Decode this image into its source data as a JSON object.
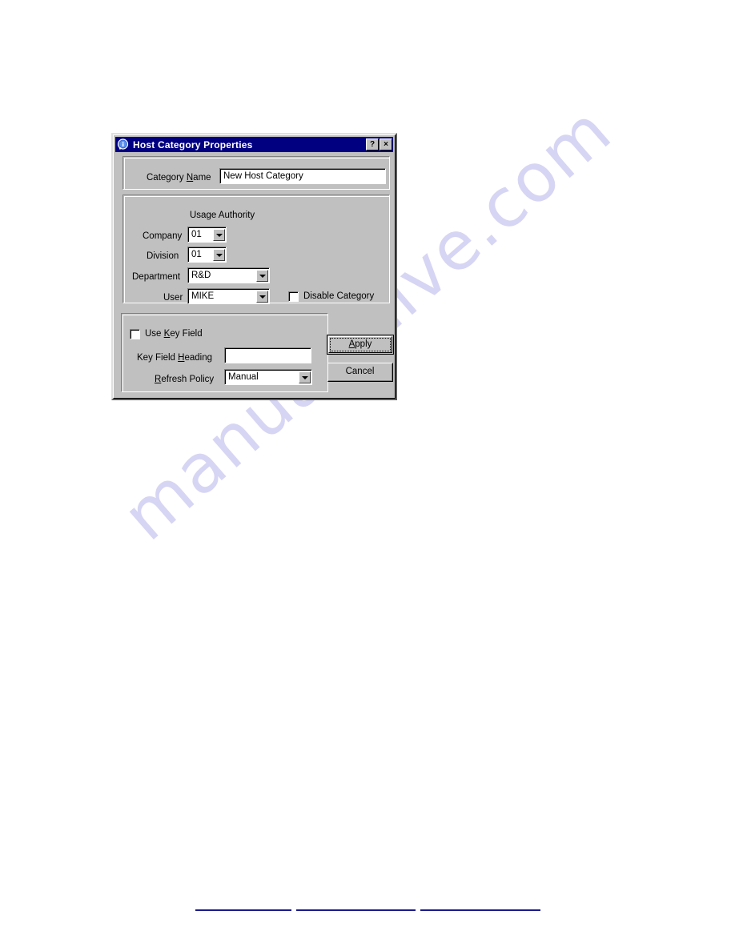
{
  "page": {
    "background_color": "#ffffff",
    "watermark_text": "manualshive.com",
    "watermark_color": "#d6d5f3",
    "link_rule_color": "#1b1b8c"
  },
  "dialog": {
    "title": "Host Category Properties",
    "title_icon": "info-circle-icon",
    "title_bar_color": "#000080",
    "face_color": "#c0c0c0",
    "help_button_label": "?",
    "close_button_label": "×",
    "category": {
      "name_label_pre": "Category ",
      "name_label_accel": "N",
      "name_label_post": "ame",
      "name_value": "New Host Category"
    },
    "usage_authority": {
      "group_label": "Usage Authority",
      "fields": [
        {
          "label": "Company",
          "value": "01",
          "control": "combobox"
        },
        {
          "label": "Division",
          "value": "01",
          "control": "combobox"
        },
        {
          "label": "Department",
          "value": "R&D",
          "control": "combobox"
        },
        {
          "label": "User",
          "value": "MIKE",
          "control": "combobox"
        }
      ],
      "disable_category": {
        "label": "Disable Category",
        "checked": false
      }
    },
    "key_field": {
      "use_key_field": {
        "label_pre": "Use ",
        "label_accel": "K",
        "label_post": "ey Field",
        "checked": false
      },
      "heading_label_pre": "Key Field ",
      "heading_label_accel": "H",
      "heading_label_post": "eading",
      "heading_value": "",
      "refresh_label_pre": "",
      "refresh_label_accel": "R",
      "refresh_label_post": "efresh Policy",
      "refresh_value": "Manual"
    },
    "buttons": {
      "apply_pre": "",
      "apply_accel": "A",
      "apply_post": "pply",
      "cancel_label": "Cancel"
    }
  }
}
